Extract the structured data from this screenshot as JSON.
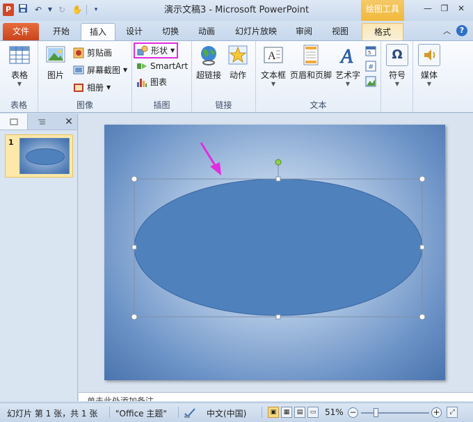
{
  "window": {
    "title": "演示文稿3 - Microsoft PowerPoint",
    "context_tab_title": "绘图工具",
    "app_icon_letter": "P"
  },
  "tabs": [
    {
      "label": "文件",
      "active": false
    },
    {
      "label": "开始",
      "active": false
    },
    {
      "label": "插入",
      "active": true
    },
    {
      "label": "设计",
      "active": false
    },
    {
      "label": "切换",
      "active": false
    },
    {
      "label": "动画",
      "active": false
    },
    {
      "label": "幻灯片放映",
      "active": false
    },
    {
      "label": "审阅",
      "active": false
    },
    {
      "label": "视图",
      "active": false
    },
    {
      "label": "格式",
      "active": false
    }
  ],
  "ribbon": {
    "groups": {
      "tables": {
        "label": "表格",
        "table_button": "表格"
      },
      "images": {
        "label": "图像",
        "picture": "图片",
        "clipart": "剪贴画",
        "screenshot": "屏幕截图",
        "album": "相册"
      },
      "illustrations": {
        "label": "插图",
        "shapes": "形状",
        "smartart": "SmartArt",
        "chart": "图表"
      },
      "links": {
        "label": "链接",
        "hyperlink": "超链接",
        "action": "动作"
      },
      "text": {
        "label": "文本",
        "textbox": "文本框",
        "header_footer": "页眉和页脚",
        "wordart": "艺术字"
      },
      "symbols": {
        "label": "",
        "symbol": "符号",
        "symbol_glyph": "Ω"
      },
      "media": {
        "label": "",
        "media": "媒体"
      }
    }
  },
  "slides_pane": {
    "thumbnail_number": "1"
  },
  "notes": {
    "placeholder": "单击此处添加备注"
  },
  "statusbar": {
    "slide_info": "幻灯片 第 1 张，共 1 张",
    "theme": "\"Office 主题\"",
    "language": "中文(中国)",
    "zoom": "51%",
    "zoom_fraction": 0.51
  },
  "colors": {
    "accent_highlight": "#e22ce0",
    "shape_fill": "#4f81bd",
    "file_tab": "#d24726",
    "context_tab": "#f0b93a"
  }
}
